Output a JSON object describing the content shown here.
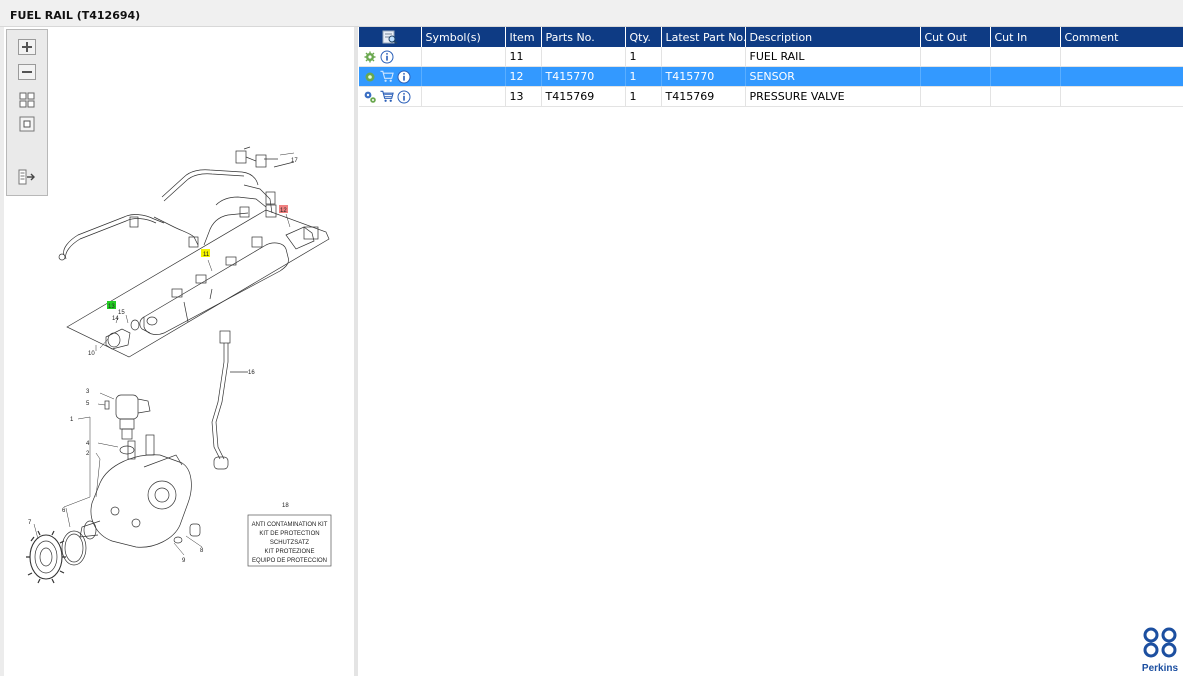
{
  "window": {
    "title": "FUEL RAIL (T412694)"
  },
  "toolbar": {
    "buttons": [
      {
        "name": "zoom-in",
        "icon": "zoom-in-icon"
      },
      {
        "name": "zoom-out",
        "icon": "zoom-out-icon"
      },
      {
        "name": "fit-page",
        "icon": "fit-page-icon"
      },
      {
        "name": "actual-size",
        "icon": "actual-size-icon"
      },
      {
        "name": "export",
        "icon": "export-icon"
      }
    ]
  },
  "diagram": {
    "callouts": [
      "17",
      "12",
      "11",
      "13",
      "15",
      "14",
      "10",
      "16",
      "3",
      "5",
      "1",
      "4",
      "2",
      "7",
      "6",
      "8",
      "9",
      "18"
    ],
    "highlight_colors": {
      "11": "#f4f400",
      "12": "#f08080",
      "13": "#22cc22"
    },
    "kit_box": [
      "ANTI CONTAMINATION KIT",
      "KIT DE PROTECTION",
      "SCHUTZSATZ",
      "KIT PROTEZIONE",
      "EQUIPO DE PROTECCION"
    ]
  },
  "table": {
    "headers": [
      "",
      "Symbol(s)",
      "Item",
      "Parts No.",
      "Qty.",
      "Latest Part No.",
      "Description",
      "Cut Out",
      "Cut In",
      "Comment"
    ],
    "rows": [
      {
        "icons": [
          "gear-icon",
          "info-icon"
        ],
        "symbols": "",
        "item": "11",
        "part_no": "",
        "qty": "1",
        "latest_part_no": "",
        "description": "FUEL RAIL",
        "cut_out": "",
        "cut_in": "",
        "comment": ""
      },
      {
        "icons": [
          "gear-icon",
          "cart-icon",
          "info-icon"
        ],
        "symbols": "",
        "item": "12",
        "part_no": "T415770",
        "qty": "1",
        "latest_part_no": "T415770",
        "description": "SENSOR",
        "cut_out": "",
        "cut_in": "",
        "comment": "",
        "selected": true
      },
      {
        "icons": [
          "gears-icon",
          "cart-icon",
          "info-icon"
        ],
        "symbols": "",
        "item": "13",
        "part_no": "T415769",
        "qty": "1",
        "latest_part_no": "T415769",
        "description": "PRESSURE VALVE",
        "cut_out": "",
        "cut_in": "",
        "comment": ""
      }
    ]
  },
  "brand": {
    "name": "Perkins",
    "color": "#1c4fa0"
  },
  "colors": {
    "header": "#0e3b84",
    "selection": "#3399ff"
  }
}
